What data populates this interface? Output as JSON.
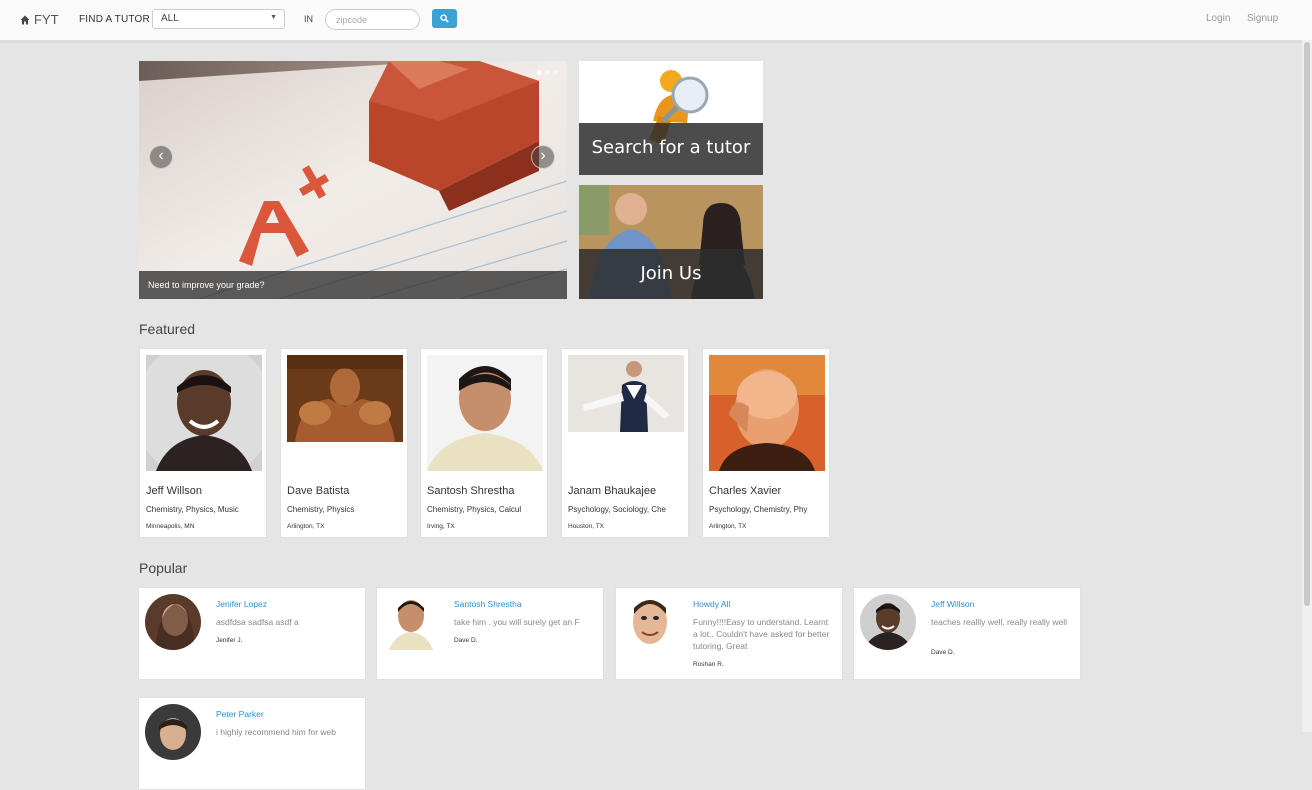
{
  "navbar": {
    "brand": "FYT",
    "find_label": "FIND A TUTOR",
    "category_selected": "ALL",
    "in_label": "IN",
    "zip_placeholder": "zipcode",
    "login": "Login",
    "signup": "Signup"
  },
  "carousel": {
    "caption": "Need to improve your grade?",
    "prev": "‹",
    "next": "›",
    "slides": 3,
    "active_slide": 1
  },
  "promos": {
    "search": "Search for a tutor",
    "join": "Join Us"
  },
  "featured": {
    "title": "Featured",
    "tutors": [
      {
        "name": "Jeff Willson",
        "subjects": "Chemistry, Physics, Music",
        "location": "Minneapolis, MN"
      },
      {
        "name": "Dave Batista",
        "subjects": "Chemistry, Physics",
        "location": "Arlington, TX"
      },
      {
        "name": "Santosh Shrestha",
        "subjects": "Chemistry, Physics, Calcul",
        "location": "Irving, TX"
      },
      {
        "name": "Janam Bhaukajee",
        "subjects": "Psychology, Sociology, Che",
        "location": "Houston, TX"
      },
      {
        "name": "Charles Xavier",
        "subjects": "Psychology, Chemistry, Phy",
        "location": "Arlington, TX"
      }
    ]
  },
  "popular": {
    "title": "Popular",
    "reviews": [
      {
        "tutor": "Jenifer Lopez",
        "text": "asdfdsa sadfsa asdf a",
        "author": "Jenifer J."
      },
      {
        "tutor": "Santosh Shrestha",
        "text": "take him . you will surely get an F",
        "author": "Dave D."
      },
      {
        "tutor": "Howdy All",
        "text": "Funny!!!!Easy to understand. Learnt a lot.. Couldn't have asked for better tutoring. Great",
        "author": "Roshan R."
      },
      {
        "tutor": "Jeff Willson",
        "text": "teaches reallly well. really really well",
        "author": "Dave D."
      },
      {
        "tutor": "Peter Parker",
        "text": "i highly recommend him for web",
        "author": ""
      }
    ]
  },
  "colors": {
    "accent": "#3aa3d3",
    "link": "#2a8fd0",
    "background": "#e5e5e5"
  }
}
